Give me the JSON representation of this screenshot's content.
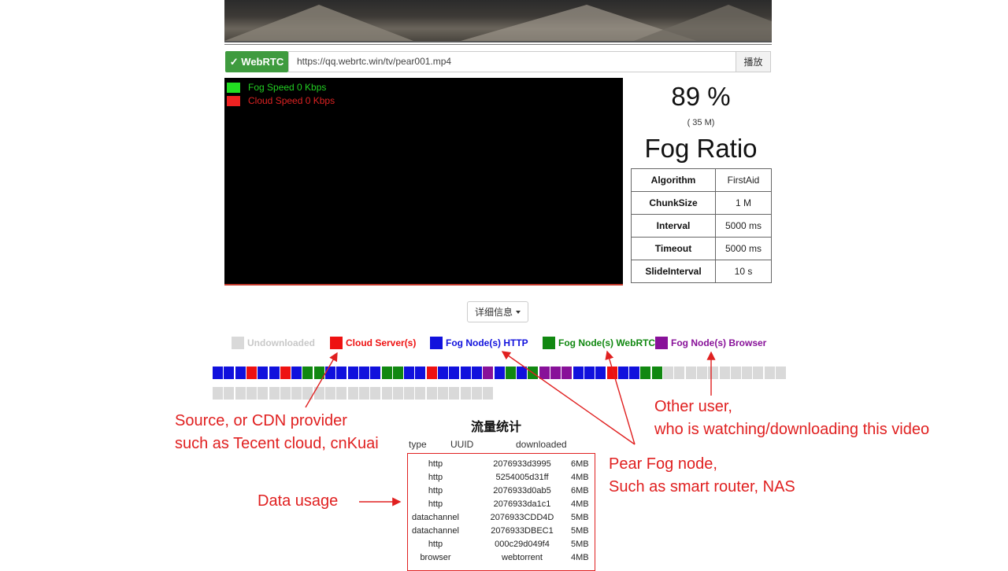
{
  "player": {
    "webrtc_label": "✓ WebRTC",
    "url_value": "https://qq.webrtc.win/tv/pear001.mp4",
    "play_label": "播放"
  },
  "speed_legend": {
    "fog_label": "Fog Speed 0 Kbps",
    "cloud_label": "Cloud Speed 0 Kbps"
  },
  "ratio": {
    "percent": "89 %",
    "size": "( 35 M)",
    "title": "Fog Ratio"
  },
  "params": [
    {
      "key": "Algorithm",
      "value": "FirstAid"
    },
    {
      "key": "ChunkSize",
      "value": "1 M"
    },
    {
      "key": "Interval",
      "value": "5000 ms"
    },
    {
      "key": "Timeout",
      "value": "5000 ms"
    },
    {
      "key": "SlideInterval",
      "value": "10 s"
    }
  ],
  "details_label": "详细信息",
  "chunk_legend": [
    {
      "label": "Undownloaded",
      "color": "#d9d9d9"
    },
    {
      "label": "Cloud Server(s)",
      "color": "#ee1111"
    },
    {
      "label": "Fog Node(s) HTTP",
      "color": "#1111dd"
    },
    {
      "label": "Fog Node(s) WebRTC",
      "color": "#118811"
    },
    {
      "label": "Fog Node(s) Browser",
      "color": "#881199"
    }
  ],
  "chunks": [
    "B",
    "B",
    "B",
    "R",
    "B",
    "B",
    "R",
    "B",
    "G",
    "G",
    "B",
    "B",
    "B",
    "B",
    "B",
    "G",
    "G",
    "B",
    "B",
    "R",
    "B",
    "B",
    "B",
    "B",
    "P",
    "B",
    "G",
    "B",
    "G",
    "P",
    "P",
    "P",
    "B",
    "B",
    "B",
    "R",
    "B",
    "B",
    "G",
    "G",
    "U",
    "U",
    "U",
    "U",
    "U",
    "U",
    "U",
    "U",
    "U",
    "U",
    "U",
    "U",
    "U",
    "U",
    "U",
    "U",
    "U",
    "U",
    "U",
    "U",
    "U",
    "U",
    "U",
    "U",
    "U",
    "U",
    "U",
    "U",
    "U",
    "U",
    "U",
    "U",
    "U",
    "U",
    "U",
    "U"
  ],
  "annotations": {
    "source_line1": "Source, or CDN provider",
    "source_line2": "such as Tecent cloud, cnKuai",
    "other_line1": "Other user,",
    "other_line2": "who is watching/downloading this video",
    "pear_line1": "Pear Fog node,",
    "pear_line2": "Such as smart router, NAS",
    "data_usage": "Data usage"
  },
  "stats": {
    "title": "流量统计",
    "headers": {
      "type": "type",
      "uuid": "UUID",
      "downloaded": "downloaded"
    },
    "rows": [
      {
        "type": "http",
        "uuid": "2076933d3995",
        "downloaded": "6MB"
      },
      {
        "type": "http",
        "uuid": "5254005d31ff",
        "downloaded": "4MB"
      },
      {
        "type": "http",
        "uuid": "2076933d0ab5",
        "downloaded": "6MB"
      },
      {
        "type": "http",
        "uuid": "2076933da1c1",
        "downloaded": "4MB"
      },
      {
        "type": "datachannel",
        "uuid": "2076933CDD4D",
        "downloaded": "5MB"
      },
      {
        "type": "datachannel",
        "uuid": "2076933DBEC1",
        "downloaded": "5MB"
      },
      {
        "type": "http",
        "uuid": "000c29d049f4",
        "downloaded": "5MB"
      },
      {
        "type": "browser",
        "uuid": "webtorrent",
        "downloaded": "4MB"
      }
    ]
  }
}
